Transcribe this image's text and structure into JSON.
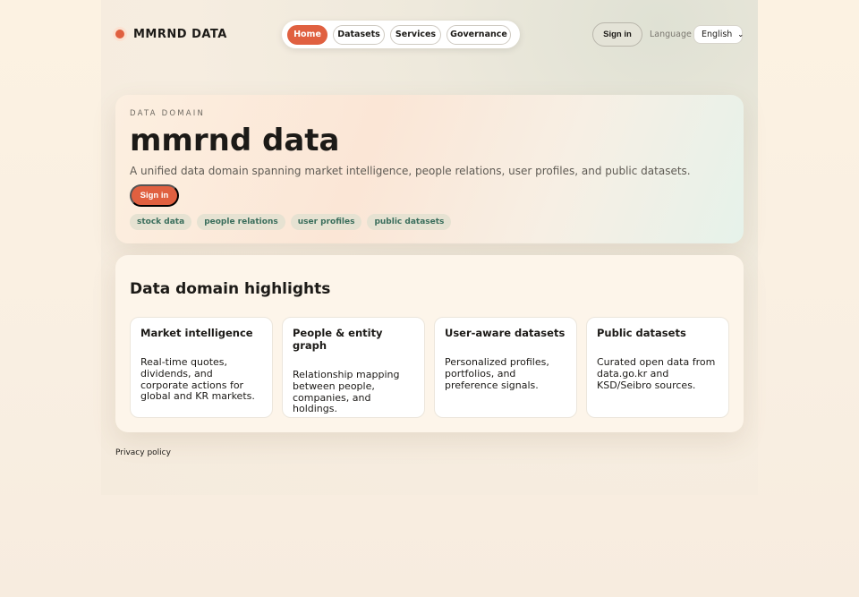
{
  "brand": {
    "name": "MMRND DATA"
  },
  "nav": {
    "items": [
      {
        "label": "Home",
        "active": true
      },
      {
        "label": "Datasets",
        "active": false
      },
      {
        "label": "Services",
        "active": false
      },
      {
        "label": "Governance",
        "active": false
      }
    ]
  },
  "header": {
    "signin_label": "Sign in",
    "language_label": "Language",
    "language_selected": "English"
  },
  "hero": {
    "eyebrow": "DATA DOMAIN",
    "title": "mmrnd data",
    "subtitle": "A unified data domain spanning market intelligence, people relations, user profiles, and public datasets.",
    "button_label": "Sign in",
    "tags": [
      "stock data",
      "people relations",
      "user profiles",
      "public datasets"
    ]
  },
  "highlights": {
    "title": "Data domain highlights",
    "cards": [
      {
        "title": "Market intelligence",
        "body": "Real-time quotes, dividends, and corporate actions for global and KR markets."
      },
      {
        "title": "People & entity graph",
        "body": "Relationship mapping between people, companies, and holdings."
      },
      {
        "title": "User-aware datasets",
        "body": "Personalized profiles, portfolios, and preference signals."
      },
      {
        "title": "Public datasets",
        "body": "Curated open data from data.go.kr and KSD/Seibro sources."
      }
    ]
  },
  "footer": {
    "privacy_label": "Privacy policy"
  },
  "colors": {
    "accent": "#e06040",
    "tag_text": "#3a6e5c",
    "tag_bg": "#e6e2d2"
  }
}
